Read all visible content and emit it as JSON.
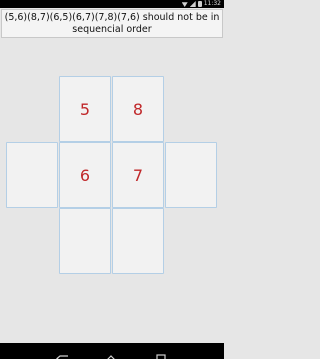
{
  "status_bar": {
    "time": "11:32"
  },
  "message": {
    "text": "(5,6)(8,7)(6,5)(6,7)(7,8)(7,6) should not be in sequencial order"
  },
  "grid": {
    "cells": [
      {
        "id": "top-left",
        "value": "5"
      },
      {
        "id": "top-right",
        "value": "8"
      },
      {
        "id": "mid-far-left",
        "value": ""
      },
      {
        "id": "mid-left",
        "value": "6"
      },
      {
        "id": "mid-right",
        "value": "7"
      },
      {
        "id": "mid-far-right",
        "value": ""
      },
      {
        "id": "bottom-left",
        "value": ""
      },
      {
        "id": "bottom-right",
        "value": ""
      }
    ]
  },
  "colors": {
    "number": "#c0282a",
    "cell_border": "#b4cfe6",
    "background": "#e6e6e6"
  },
  "icons": {
    "status": [
      "wifi-icon",
      "signal-icon",
      "battery-icon"
    ],
    "nav": [
      "back-icon",
      "home-icon",
      "recent-apps-icon"
    ]
  }
}
